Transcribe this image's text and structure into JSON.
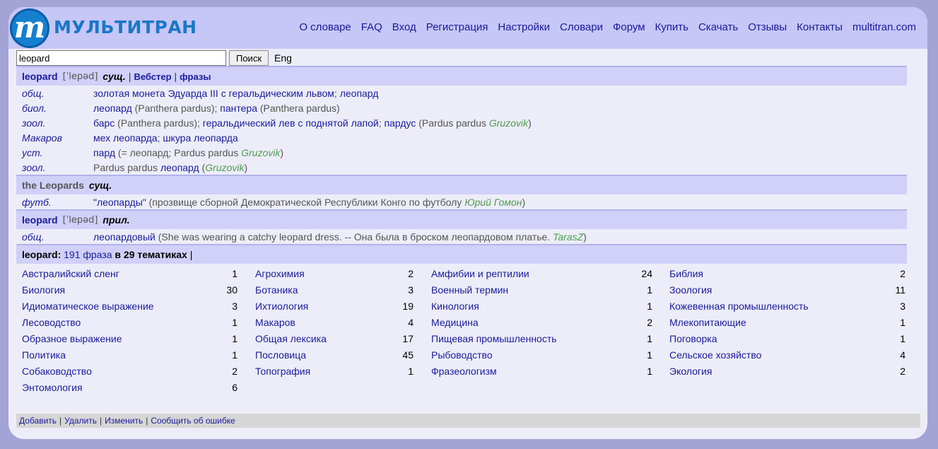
{
  "logo": {
    "letter": "m",
    "text": "МУЛЬТИТРАН"
  },
  "nav": [
    "О словаре",
    "FAQ",
    "Вход",
    "Регистрация",
    "Настройки",
    "Словари",
    "Форум",
    "Купить",
    "Скачать",
    "Отзывы",
    "Контакты",
    "multitran.com"
  ],
  "search": {
    "value": "leopard",
    "button": "Поиск",
    "lang": "Eng"
  },
  "entry1": {
    "word": "leopard",
    "transcription": "[ˈlepəd]",
    "pos": "сущ.",
    "links": [
      "Вебстер",
      "фразы"
    ],
    "rows": [
      {
        "sub": "общ.",
        "parts": [
          {
            "t": "золотая монета Эдуарда III с геральдическим львом",
            "k": "a"
          },
          {
            "t": "; ",
            "k": "p"
          },
          {
            "t": "леопард",
            "k": "a"
          }
        ]
      },
      {
        "sub": "биол.",
        "parts": [
          {
            "t": "леопард",
            "k": "a"
          },
          {
            "t": " (Panthera pardus); ",
            "k": "p"
          },
          {
            "t": "пантера",
            "k": "a"
          },
          {
            "t": " (Panthera pardus)",
            "k": "p"
          }
        ]
      },
      {
        "sub": "зоол.",
        "parts": [
          {
            "t": "барс",
            "k": "a"
          },
          {
            "t": " (Panthera pardus); ",
            "k": "p"
          },
          {
            "t": "геральдический лев с поднятой лапой",
            "k": "a"
          },
          {
            "t": "; ",
            "k": "p"
          },
          {
            "t": "пардус",
            "k": "a"
          },
          {
            "t": " (Pardus pardus ",
            "k": "p"
          },
          {
            "t": "Gruzovik",
            "k": "u"
          },
          {
            "t": ")",
            "k": "p"
          }
        ]
      },
      {
        "sub": "Макаров",
        "parts": [
          {
            "t": "мех леопарда",
            "k": "a"
          },
          {
            "t": "; ",
            "k": "p"
          },
          {
            "t": "шкура леопарда",
            "k": "a"
          }
        ]
      },
      {
        "sub": "уст.",
        "parts": [
          {
            "t": "пард",
            "k": "a"
          },
          {
            "t": " (= леопард; Pardus pardus ",
            "k": "p"
          },
          {
            "t": "Gruzovik",
            "k": "u"
          },
          {
            "t": ")",
            "k": "p"
          }
        ]
      },
      {
        "sub": "зоол.",
        "parts": [
          {
            "t": "Pardus pardus ",
            "k": "p"
          },
          {
            "t": "леопард",
            "k": "a"
          },
          {
            "t": " (",
            "k": "p"
          },
          {
            "t": "Gruzovik",
            "k": "u"
          },
          {
            "t": ")",
            "k": "p"
          }
        ]
      }
    ]
  },
  "entry2": {
    "word": "the Leopards",
    "pos": "сущ.",
    "rows": [
      {
        "sub": "футб.",
        "parts": [
          {
            "t": "\"леопарды\"",
            "k": "a"
          },
          {
            "t": " (прозвище сборной Демократической Республики Конго по футболу ",
            "k": "p"
          },
          {
            "t": "Юрий Гомон",
            "k": "u"
          },
          {
            "t": ")",
            "k": "p"
          }
        ]
      }
    ]
  },
  "entry3": {
    "word": "leopard",
    "transcription": "[ˈlepəd]",
    "pos": "прил.",
    "rows": [
      {
        "sub": "общ.",
        "parts": [
          {
            "t": "леопардовый",
            "k": "a"
          },
          {
            "t": " (She was wearing a catchy leopard dress. -- Она была в броском леопардовом платье. ",
            "k": "p"
          },
          {
            "t": "TarasZ",
            "k": "u"
          },
          {
            "t": ")",
            "k": "p"
          }
        ]
      }
    ]
  },
  "phrases": {
    "word": "leopard:",
    "count_link": "191 фраза",
    "themes": "в 29 тематиках",
    "sep": "|"
  },
  "categories": [
    [
      [
        "Австралийский сленг",
        "1"
      ],
      [
        "Биология",
        "30"
      ],
      [
        "Идиоматическое выражение",
        "3"
      ],
      [
        "Лесоводство",
        "1"
      ],
      [
        "Образное выражение",
        "1"
      ],
      [
        "Политика",
        "1"
      ],
      [
        "Собаководство",
        "2"
      ],
      [
        "Энтомология",
        "6"
      ]
    ],
    [
      [
        "Агрохимия",
        "2"
      ],
      [
        "Ботаника",
        "3"
      ],
      [
        "Ихтиология",
        "19"
      ],
      [
        "Макаров",
        "4"
      ],
      [
        "Общая лексика",
        "17"
      ],
      [
        "Пословица",
        "45"
      ],
      [
        "Топография",
        "1"
      ]
    ],
    [
      [
        "Амфибии и рептилии",
        "24"
      ],
      [
        "Военный термин",
        "1"
      ],
      [
        "Кинология",
        "1"
      ],
      [
        "Медицина",
        "2"
      ],
      [
        "Пищевая промышленность",
        "1"
      ],
      [
        "Рыбоводство",
        "1"
      ],
      [
        "Фразеологизм",
        "1"
      ]
    ],
    [
      [
        "Библия",
        "2"
      ],
      [
        "Зоология",
        "11"
      ],
      [
        "Кожевенная промышленность",
        "3"
      ],
      [
        "Млекопитающие",
        "1"
      ],
      [
        "Поговорка",
        "1"
      ],
      [
        "Сельское хозяйство",
        "4"
      ],
      [
        "Экология",
        "2"
      ]
    ]
  ],
  "footer": [
    "Добавить",
    "Удалить",
    "Изменить",
    "Сообщить об ошибке"
  ],
  "colors": {
    "page_bg": "#a3a3d6",
    "header_bg": "#c6c6f7",
    "section_bg": "#d0d0f9",
    "link": "#1a1a9c",
    "author": "#4f9b4f"
  }
}
